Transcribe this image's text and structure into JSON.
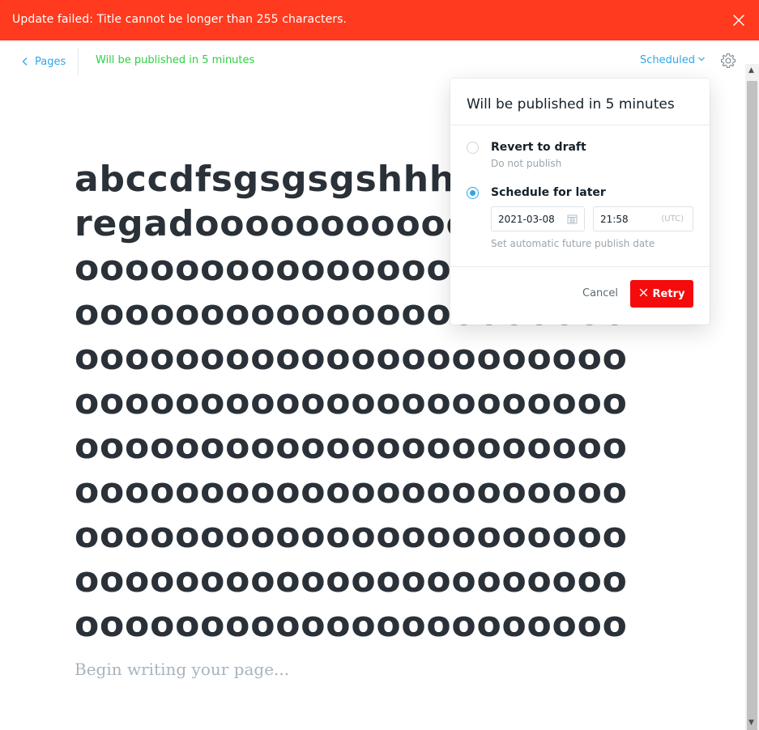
{
  "alert": {
    "message": "Update failed: Title cannot be longer than 255 characters.",
    "close_icon": "close-icon",
    "color": "#ff3a1e"
  },
  "header": {
    "back_label": "Pages",
    "back_icon": "chevron-left-icon",
    "status": "Will be published in 5 minutes",
    "status_color": "#30cf43",
    "publish_menu_label": "Scheduled",
    "publish_menu_icon": "chevron-down-icon",
    "settings_icon": "gear-icon",
    "accent": "#2fa6e6"
  },
  "editor": {
    "title": "abccdfsgsgsgshhh..testeagregadoooooooooooooooooooooooooooooooooooooooooooooooooooooooooooooooooooooooooooooooooooooooooooooooooooooooooooooooooooooooooooooooooooooooooooooooooooooooooooooooooooooooooooooooooooooooooooooooooooooooooooooooooooooooooooooooooooooooooooooooooooooooooooooooooooooooooo",
    "body_placeholder": "Begin writing your page..."
  },
  "publish_popover": {
    "title": "Will be published in 5 minutes",
    "options": [
      {
        "label": "Revert to draft",
        "sublabel": "Do not publish",
        "selected": false
      },
      {
        "label": "Schedule for later",
        "sublabel": "",
        "selected": true
      }
    ],
    "date": "2021-03-08",
    "date_icon": "calendar-icon",
    "time": "21:58",
    "timezone": "(UTC)",
    "hint": "Set automatic future publish date",
    "cancel_label": "Cancel",
    "retry_label": "Retry",
    "retry_icon": "close-icon",
    "retry_color": "#f50b0b"
  }
}
